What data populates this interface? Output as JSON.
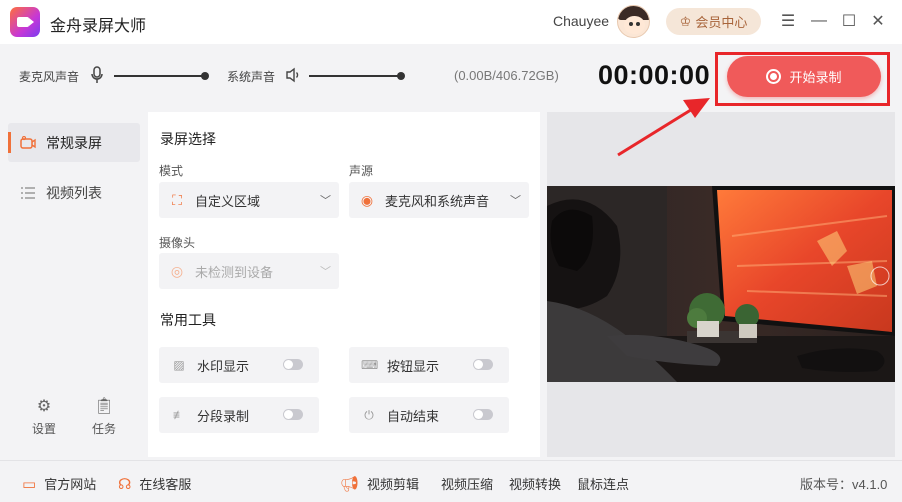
{
  "app": {
    "title": "金舟录屏大师"
  },
  "user": {
    "name": "Chauyee",
    "vip_label": "会员中心"
  },
  "window_controls": {
    "menu": "☰",
    "minimize": "—",
    "maximize": "☐",
    "close": "✕"
  },
  "toolbar": {
    "mic_label": "麦克风声音",
    "mic_level": 1.0,
    "system_label": "系统声音",
    "system_level": 1.0,
    "storage": "(0.00B/406.72GB)",
    "timer": "00:00:00",
    "record_button": "开始录制"
  },
  "sidebar": {
    "items": [
      {
        "label": "常规录屏",
        "icon": "camera-icon",
        "active": true
      },
      {
        "label": "视频列表",
        "icon": "list-icon",
        "active": false
      }
    ],
    "bottom": [
      {
        "label": "设置",
        "icon": "gear-icon"
      },
      {
        "label": "任务",
        "icon": "clipboard-icon"
      }
    ]
  },
  "panel": {
    "record_section_title": "录屏选择",
    "mode_label": "模式",
    "mode_value": "自定义区域",
    "audio_label": "声源",
    "audio_value": "麦克风和系统声音",
    "camera_label": "摄像头",
    "camera_value": "未检测到设备",
    "tools_title": "常用工具",
    "tools": [
      {
        "label": "水印显示",
        "icon": "watermark-icon",
        "on": false
      },
      {
        "label": "按钮显示",
        "icon": "keyboard-icon",
        "on": false
      },
      {
        "label": "分段录制",
        "icon": "segment-icon",
        "on": false
      },
      {
        "label": "自动结束",
        "icon": "power-icon",
        "on": false
      }
    ]
  },
  "footer": {
    "website": "官方网站",
    "support": "在线客服",
    "video_edit": "视频剪辑",
    "video_compress": "视频压缩",
    "video_convert": "视频转换",
    "mouse_click": "鼠标连点",
    "version": "版本号：v4.1.0"
  },
  "colors": {
    "accent": "#f0713a",
    "record": "#f05a5a",
    "highlight": "#e8262a"
  }
}
